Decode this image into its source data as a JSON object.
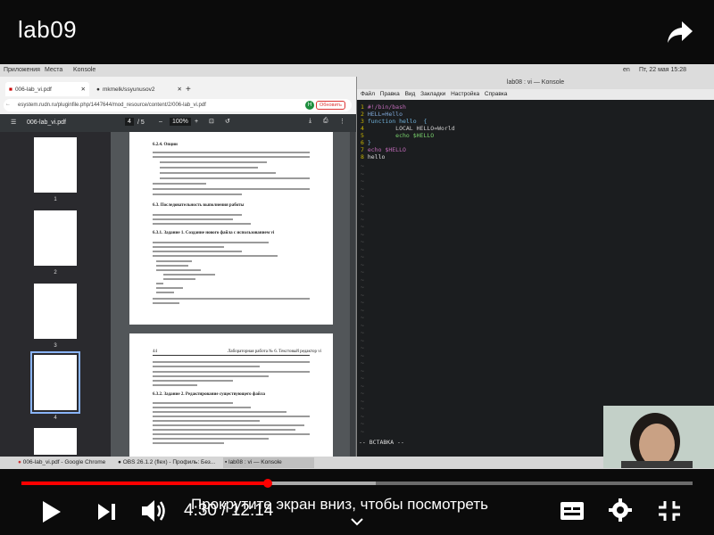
{
  "video": {
    "title": "lab09",
    "time": "4:30 / 12:14",
    "progress_fraction": 0.367,
    "buffered_fraction": 0.528,
    "hint": "Прокрутите экран вниз, чтобы посмотреть"
  },
  "desktop_top": {
    "menu1": "Приложения",
    "menu2": "Места",
    "menu3": "Konsole",
    "lang": "en",
    "clock": "Пт, 22 мая 15:28"
  },
  "browser": {
    "tab1": "006-lab_vi.pdf",
    "tab2": "mkmelk/ssyunusov2",
    "url": "esystem.rudn.ru/pluginfile.php/1447644/mod_resource/content/2/006-lab_vi.pdf",
    "update_label": "Обновить",
    "avatar_letter": "H"
  },
  "pdf": {
    "filename": "006-lab_vi.pdf",
    "page": "4",
    "pages": "/ 5",
    "zoom": "100%",
    "thumb_labels": [
      "1",
      "2",
      "3",
      "4"
    ],
    "section_options": "6.2.4. Опции",
    "section_exec": "6.3. Последовательность выполнения работы",
    "task1": "6.3.1. Задание 1. Создание нового файла с использованием vi",
    "footer_num": "44",
    "footer_title": "Лабораторная работа № 6. Текстовый редактор vi",
    "task2": "6.3.2. Задание 2. Редактирование существующего файла"
  },
  "konsole": {
    "title": "lab08 : vi — Konsole",
    "menu": [
      "Файл",
      "Правка",
      "Вид",
      "Закладки",
      "Настройка",
      "Справка"
    ],
    "lines": [
      {
        "n": "1",
        "t": "#!/bin/bash"
      },
      {
        "n": "2",
        "t": "HELL=Hello"
      },
      {
        "n": "3",
        "t": "function hello  {"
      },
      {
        "n": "4",
        "t": "        LOCAL HELLO=World"
      },
      {
        "n": "5",
        "t": "        echo $HELLO"
      },
      {
        "n": "6",
        "t": "}"
      },
      {
        "n": "7",
        "t": "echo $HELLO"
      },
      {
        "n": "8",
        "t": "hello"
      }
    ],
    "tilde": "~",
    "mode": "-- ВСТАВКА --"
  },
  "taskbar": {
    "item1": "006-lab_vi.pdf - Google Chrome",
    "item2": "OBS 26.1.2 (flex) - Профиль: Без...",
    "item3": "lab08 : vi — Konsole"
  },
  "colors": {
    "progress": "#ff0000",
    "konsole_bg": "#1b1d1f",
    "line_number": "#c8b400"
  }
}
